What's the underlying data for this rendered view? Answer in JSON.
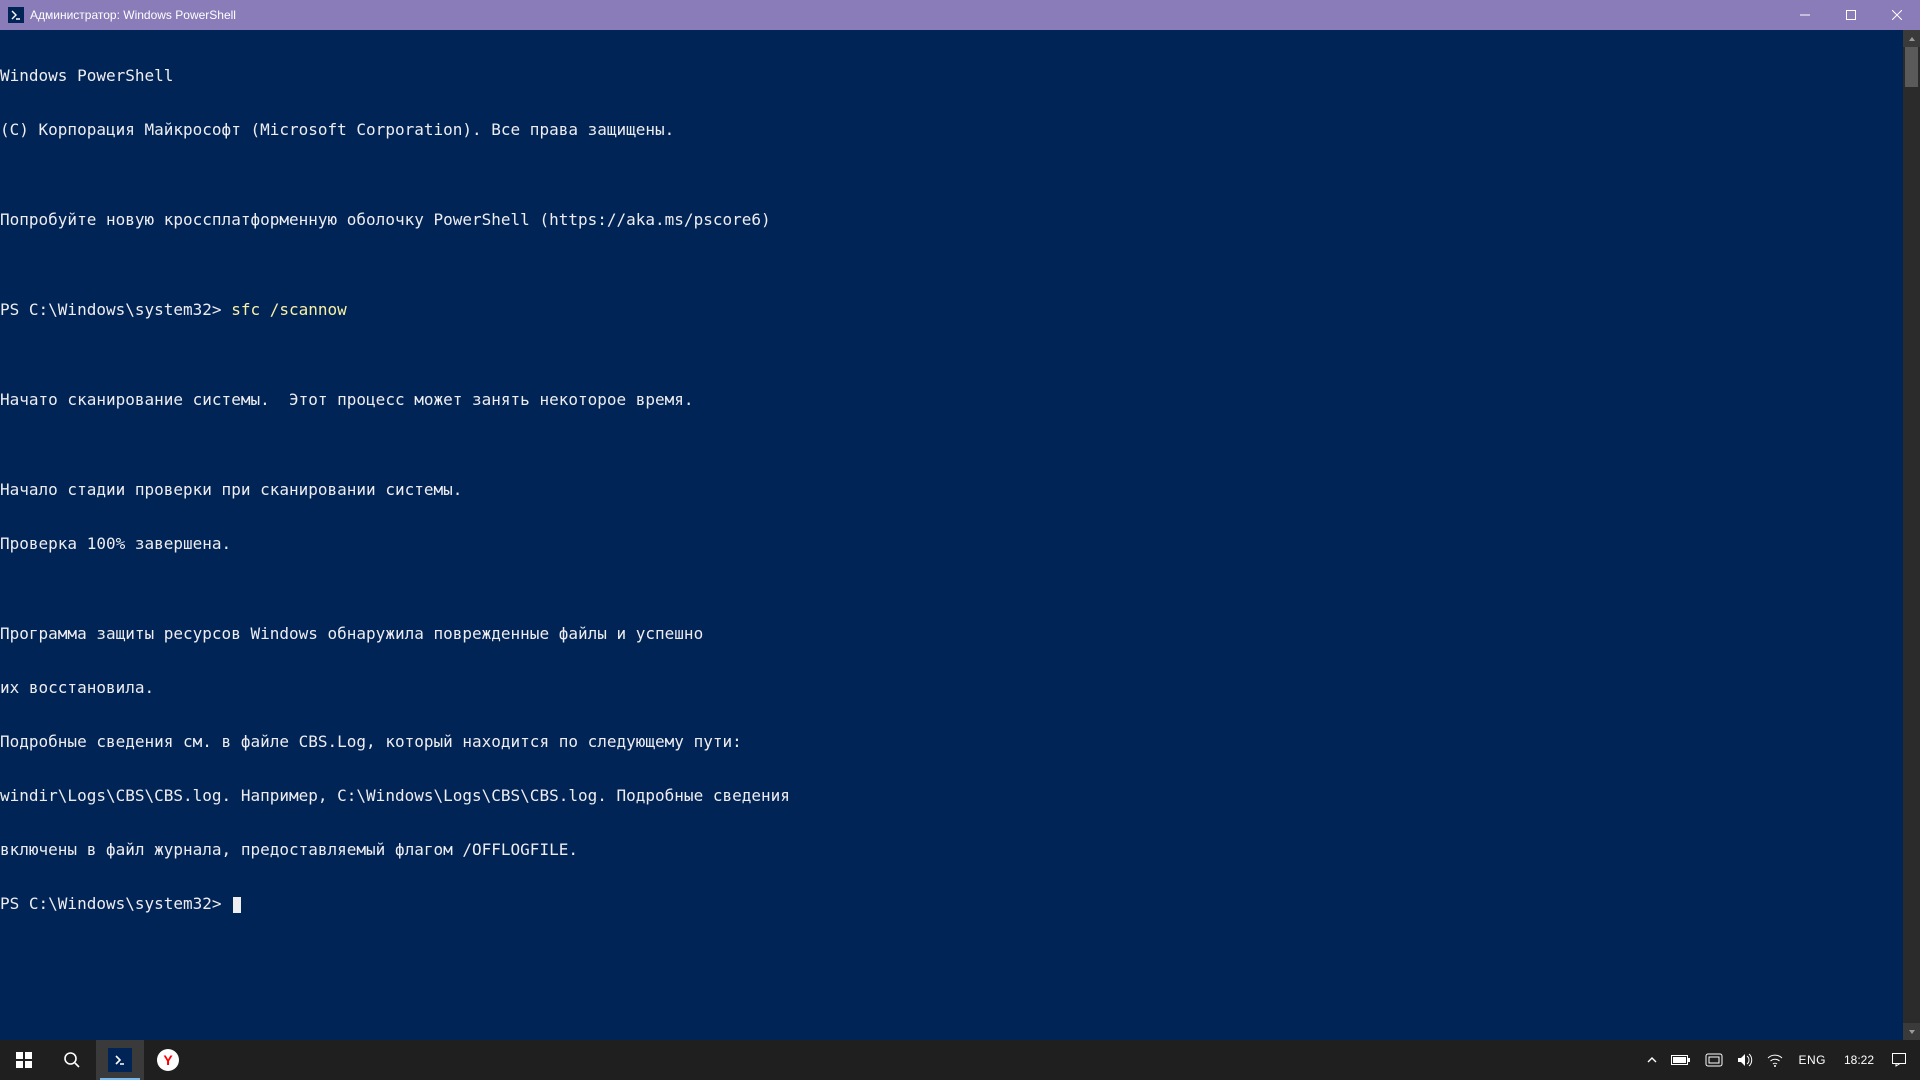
{
  "window": {
    "title": "Администратор: Windows PowerShell"
  },
  "terminal": {
    "lines": [
      "Windows PowerShell",
      "(C) Корпорация Майкрософт (Microsoft Corporation). Все права защищены.",
      "",
      "Попробуйте новую кроссплатформенную оболочку PowerShell (https://aka.ms/pscore6)",
      ""
    ],
    "prompt1": "PS C:\\Windows\\system32> ",
    "cmd1": "sfc /scannow",
    "lines2": [
      "",
      "Начато сканирование системы.  Этот процесс может занять некоторое время.",
      "",
      "Начало стадии проверки при сканировании системы.",
      "Проверка 100% завершена.",
      "",
      "Программа защиты ресурсов Windows обнаружила поврежденные файлы и успешно",
      "их восстановила.",
      "Подробные сведения см. в файле CBS.Log, который находится по следующему пути:",
      "windir\\Logs\\CBS\\CBS.log. Например, C:\\Windows\\Logs\\CBS\\CBS.log. Подробные сведения",
      "включены в файл журнала, предоставляемый флагом /OFFLOGFILE."
    ],
    "prompt2": "PS C:\\Windows\\system32> "
  },
  "taskbar": {
    "lang": "ENG",
    "clock": "18:22"
  }
}
